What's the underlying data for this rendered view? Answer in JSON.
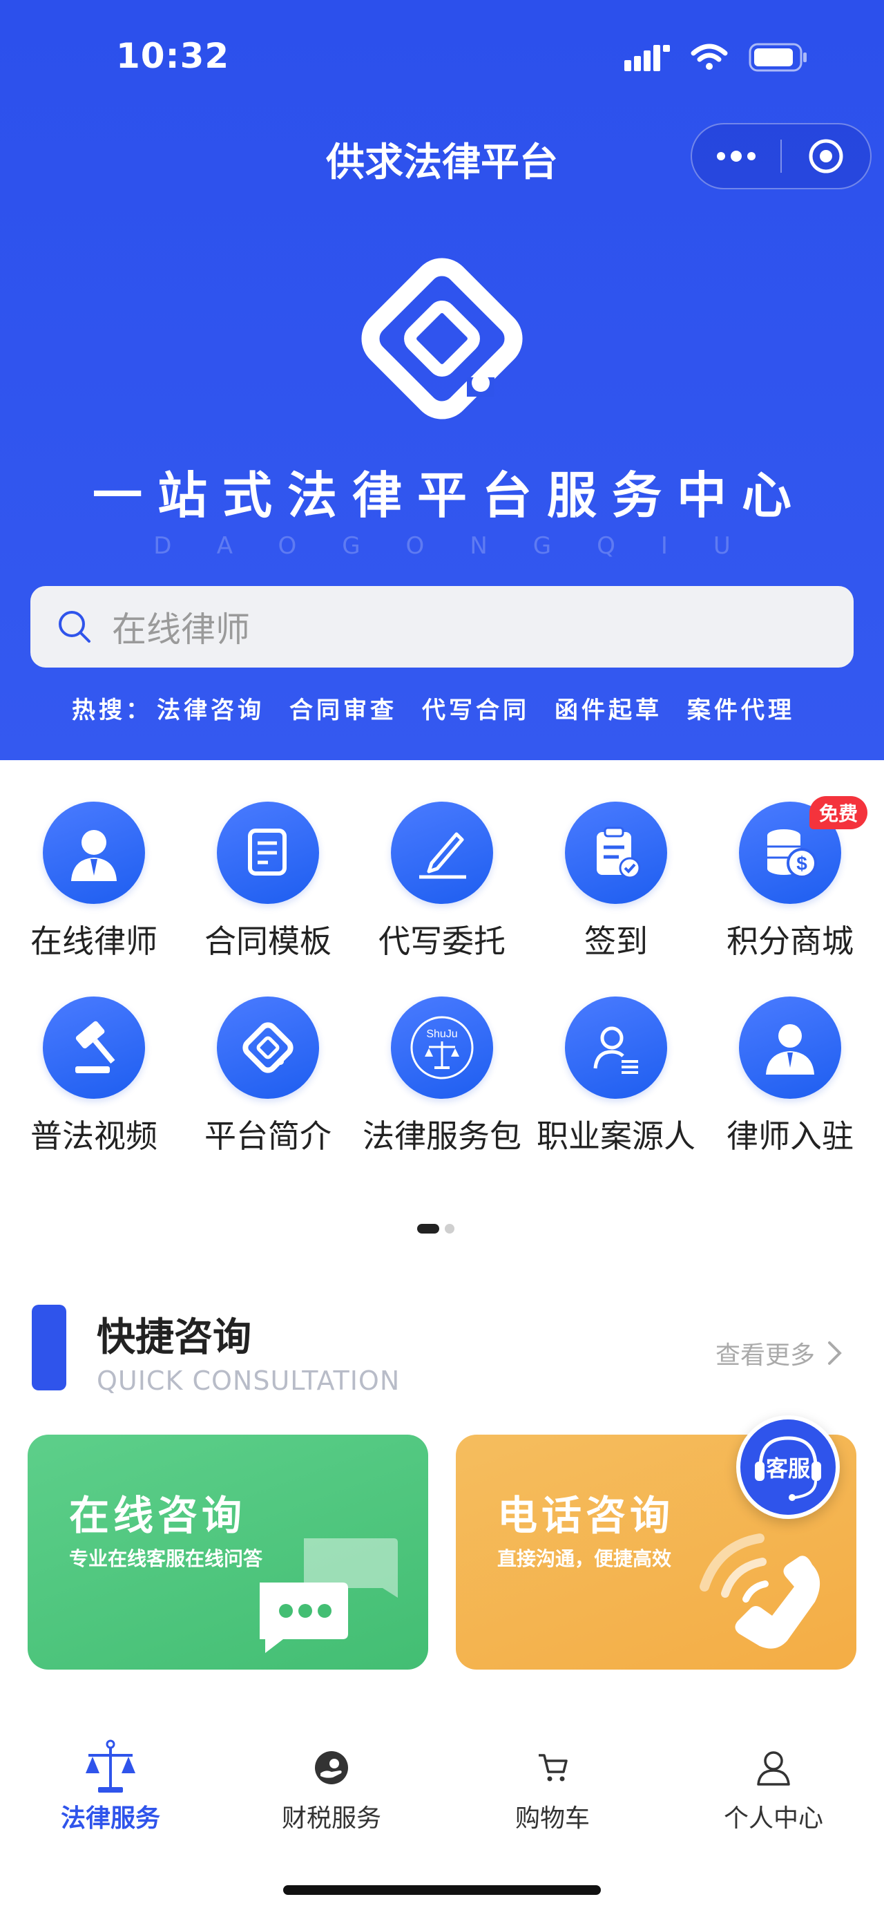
{
  "status_bar": {
    "time": "10:32"
  },
  "nav": {
    "title": "供求法律平台"
  },
  "hero": {
    "slogan": "一站式法律平台服务中心",
    "slogan_en": "DAOGONGQIU"
  },
  "search": {
    "placeholder": "在线律师"
  },
  "hot_search": {
    "label": "热搜：",
    "items": [
      "法律咨询",
      "合同审查",
      "代写合同",
      "函件起草",
      "案件代理"
    ]
  },
  "grid": {
    "items": [
      {
        "label": "在线律师",
        "icon": "lawyer-avatar-icon"
      },
      {
        "label": "合同模板",
        "icon": "document-edit-icon"
      },
      {
        "label": "代写委托",
        "icon": "pen-icon"
      },
      {
        "label": "签到",
        "icon": "clipboard-check-icon"
      },
      {
        "label": "积分商城",
        "icon": "coins-icon",
        "badge": "免费"
      },
      {
        "label": "普法视频",
        "icon": "gavel-icon"
      },
      {
        "label": "平台简介",
        "icon": "platform-logo-icon"
      },
      {
        "label": "法律服务包",
        "icon": "scales-emblem-icon",
        "emblem_text": "ShuJu"
      },
      {
        "label": "职业案源人",
        "icon": "person-list-icon"
      },
      {
        "label": "律师入驻",
        "icon": "person-tie-icon"
      }
    ]
  },
  "pager": {
    "pages": 2,
    "current": 1
  },
  "quick": {
    "title": "快捷咨询",
    "subtitle": "QUICK CONSULTATION",
    "more": "查看更多",
    "cards": [
      {
        "title": "在线咨询",
        "subtitle": "专业在线客服在线问答",
        "color": "#4fc47d"
      },
      {
        "title": "电话咨询",
        "subtitle": "直接沟通，便捷高效",
        "color": "#f4b24f"
      }
    ],
    "service_float": "客服"
  },
  "tabbar": {
    "items": [
      {
        "label": "法律服务",
        "icon": "scales-icon",
        "active": true
      },
      {
        "label": "财税服务",
        "icon": "money-hand-icon",
        "active": false
      },
      {
        "label": "购物车",
        "icon": "cart-icon",
        "active": false
      },
      {
        "label": "个人中心",
        "icon": "user-icon",
        "active": false
      }
    ]
  },
  "colors": {
    "primary": "#2f54eb",
    "badge": "#f4333c",
    "green": "#4fc47d",
    "orange": "#f4b24f"
  }
}
